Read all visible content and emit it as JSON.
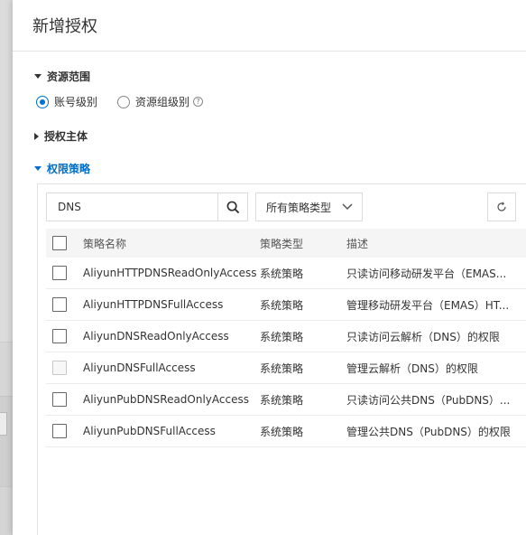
{
  "drawer": {
    "title": "新增授权"
  },
  "sections": {
    "scope": "资源范围",
    "principal": "授权主体",
    "policy": "权限策略"
  },
  "scope_options": [
    {
      "label": "账号级别",
      "checked": true
    },
    {
      "label": "资源组级别",
      "checked": false
    }
  ],
  "help_glyph": "?",
  "search": {
    "value": "DNS"
  },
  "policy_type_select": {
    "selected": "所有策略类型"
  },
  "table": {
    "columns": [
      "策略名称",
      "策略类型",
      "描述"
    ],
    "rows": [
      {
        "name": "AliyunHTTPDNSReadOnlyAccess",
        "type": "系统策略",
        "desc": "只读访问移动研发平台（EMAS...",
        "disabled": false
      },
      {
        "name": "AliyunHTTPDNSFullAccess",
        "type": "系统策略",
        "desc": "管理移动研发平台（EMAS）HT...",
        "disabled": false
      },
      {
        "name": "AliyunDNSReadOnlyAccess",
        "type": "系统策略",
        "desc": "只读访问云解析（DNS）的权限",
        "disabled": false
      },
      {
        "name": "AliyunDNSFullAccess",
        "type": "系统策略",
        "desc": "管理云解析（DNS）的权限",
        "disabled": true
      },
      {
        "name": "AliyunPubDNSReadOnlyAccess",
        "type": "系统策略",
        "desc": "只读访问公共DNS（PubDNS）...",
        "disabled": false
      },
      {
        "name": "AliyunPubDNSFullAccess",
        "type": "系统策略",
        "desc": "管理公共DNS（PubDNS）的权限",
        "disabled": false
      }
    ]
  },
  "colors": {
    "accent": "#0070cc",
    "border": "#dcdcdc",
    "header_bg": "#f5f5f5"
  },
  "icons": [
    "search-icon",
    "chevron-down-icon",
    "refresh-icon",
    "help-icon",
    "caret-down-icon",
    "caret-right-icon"
  ]
}
